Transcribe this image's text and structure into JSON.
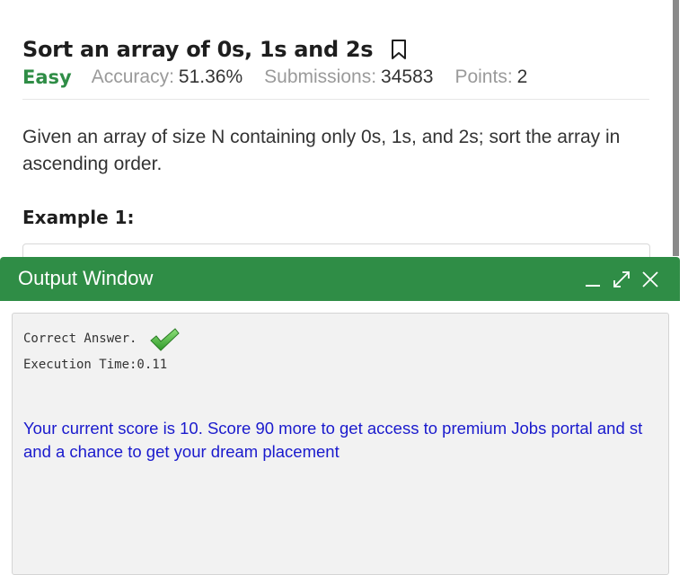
{
  "problem": {
    "title": "Sort an array of 0s, 1s and 2s",
    "difficulty": "Easy",
    "accuracy_label": "Accuracy:",
    "accuracy_value": "51.36%",
    "submissions_label": "Submissions:",
    "submissions_value": "34583",
    "points_label": "Points:",
    "points_value": "2",
    "statement": "Given an array of size N containing only 0s, 1s, and 2s; sort the array in ascending order.",
    "example_heading": "Example 1:"
  },
  "output_window": {
    "title": "Output Window",
    "result_status": "Correct Answer.",
    "execution_time": "Execution Time:0.11",
    "score_message_line1": "Your current score is 10. Score 90 more to get access to premium Jobs portal and st",
    "score_message_line2": "and a chance to get your dream placement"
  },
  "icons": {
    "bookmark": "bookmark-icon",
    "minimize": "minimize-icon",
    "maximize": "expand-icon",
    "close": "close-icon",
    "check": "check-icon"
  },
  "colors": {
    "brand_green": "#2f8d46",
    "score_text": "#1a1acd",
    "muted": "#9a9a9a"
  }
}
